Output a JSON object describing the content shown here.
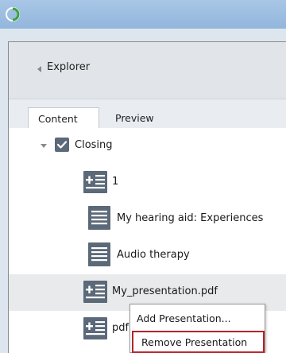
{
  "explorer": {
    "title": "Explorer"
  },
  "tabs": [
    {
      "label": "Content",
      "active": true
    },
    {
      "label": "Preview",
      "active": false
    }
  ],
  "tree": {
    "root": {
      "label": "Closing",
      "checked": true,
      "expanded": true
    },
    "items": [
      {
        "label": "1",
        "icon": "add-document-icon"
      },
      {
        "label": "My hearing aid: Experiences",
        "icon": "document-icon"
      },
      {
        "label": "Audio therapy",
        "icon": "document-icon"
      },
      {
        "label": "My_presentation.pdf",
        "icon": "add-document-icon",
        "selected": true
      },
      {
        "label": "pdf",
        "icon": "add-document-icon"
      }
    ]
  },
  "context_menu": {
    "add_label": "Add Presentation...",
    "remove_label": "Remove Presentation"
  },
  "colors": {
    "icon_blue_gray": "#5b6978",
    "highlight_red": "#b5232a",
    "logo_green": "#3aa339"
  }
}
